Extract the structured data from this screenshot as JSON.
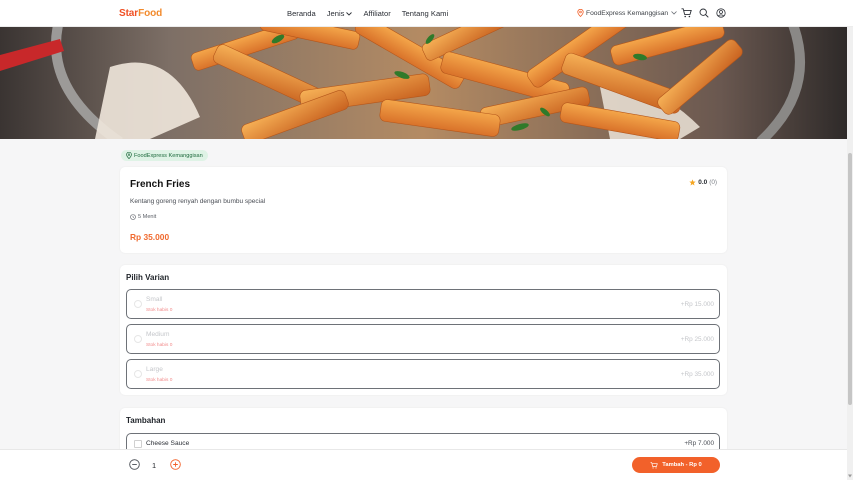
{
  "header": {
    "logo_part_a": "Star",
    "logo_part_b": "Food",
    "nav": [
      {
        "label": "Beranda"
      },
      {
        "label": "Jenis"
      },
      {
        "label": "Affiliator"
      },
      {
        "label": "Tentang Kami"
      }
    ],
    "location": "FoodExpress Kemanggisan",
    "icons": [
      "cart-icon",
      "search-icon",
      "user-icon"
    ]
  },
  "store_badge": "FoodExpress Kemanggisan",
  "product": {
    "name": "French Fries",
    "description": "Kentang goreng renyah dengan bumbu special",
    "prep_time": "5 Menit",
    "price": "Rp 35.000",
    "rating": "0.0",
    "rating_count": "(0)"
  },
  "variants": {
    "title": "Pilih Varian",
    "options": [
      {
        "name": "Small",
        "stock": "Stok habis 0",
        "price": "+Rp 15.000"
      },
      {
        "name": "Medium",
        "stock": "Stok habis 0",
        "price": "+Rp 25.000"
      },
      {
        "name": "Large",
        "stock": "Stok habis 0",
        "price": "+Rp 35.000"
      }
    ]
  },
  "addons": {
    "title": "Tambahan",
    "items": [
      {
        "name": "Cheese Sauce",
        "price": "+Rp 7.000"
      }
    ]
  },
  "footer": {
    "quantity": "1",
    "add_label": "Tambah - Rp 0"
  },
  "colors": {
    "brand_orange": "#f2612a",
    "price_orange": "#f06a2f",
    "badge_green_bg": "#dff3e6",
    "badge_green_text": "#1e6a3d",
    "stock_red": "#f28b8b",
    "star": "#f5a623"
  }
}
